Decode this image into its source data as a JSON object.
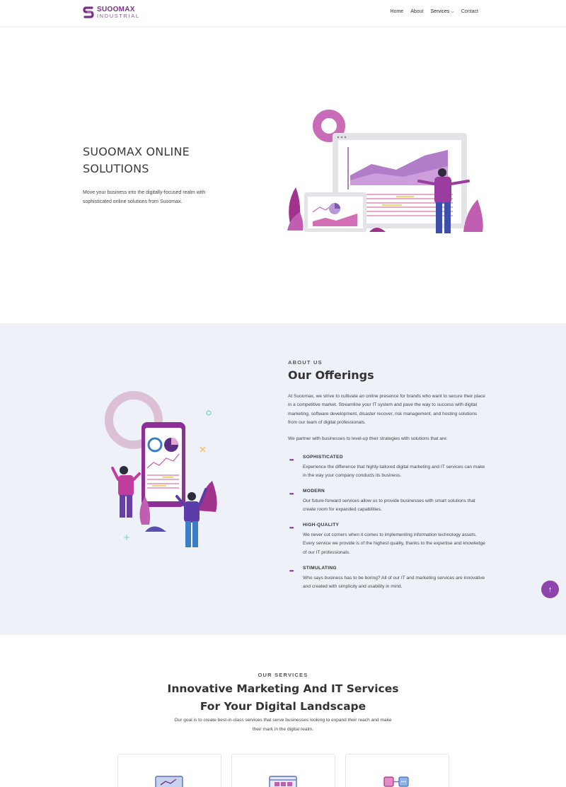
{
  "brand": {
    "name": "SUOOMAX",
    "sub": "INDUSTRIAL"
  },
  "nav": {
    "home": "Home",
    "about": "About",
    "services": "Services",
    "services_caret": "⌵",
    "contact": "Contact"
  },
  "hero": {
    "title": "SUOOMAX ONLINE SOLUTIONS",
    "description": "Move your business into the digitally-focused realm with sophisticated online solutions from Suoomax."
  },
  "about": {
    "eyebrow": "ABOUT US",
    "title": "Our Offerings",
    "paragraph1": "At Suoomax, we strive to cultivate an online presence for brands who want to secure their place in a competitive market. Streamline your IT system and pave the way to success with digital marketing, software development, disaster recover, risk management, and hosting solutions from our team of digital professionals.",
    "paragraph2": "We partner with businesses to level-up their strategies with solutions that are:",
    "features": [
      {
        "title": "SOPHISTICATED",
        "text": "Experience the difference that highly-tailored digital marketing and IT services can make in the way your company conducts its business."
      },
      {
        "title": "MODERN",
        "text": "Our future-forward services allow us to provide businesses with smart solutions that create room for expanded capabilities."
      },
      {
        "title": "HIGH-QUALITY",
        "text": "We never cut corners when it comes to implementing information technology assets. Every service we provide is of the highest quality, thanks to the expertise and knowledge of our IT professionals."
      },
      {
        "title": "STIMULATING",
        "text": "Who says business has to be boring? All of our IT and marketing services are innovative and created with simplicity and usability in mind."
      }
    ]
  },
  "services": {
    "eyebrow": "OUR SERVICES",
    "title": "Innovative Marketing And IT Services For Your Digital Landscape",
    "description": "Our goal is to create best-in-class services that serve businesses looking to expand their reach and make their mark in the digital realm."
  },
  "scroll_top": {
    "icon": "arrow-up-icon",
    "glyph": "↑"
  },
  "colors": {
    "accent": "#8e44ad",
    "brand": "#7a2f86",
    "section_bg": "#eef1f8"
  }
}
